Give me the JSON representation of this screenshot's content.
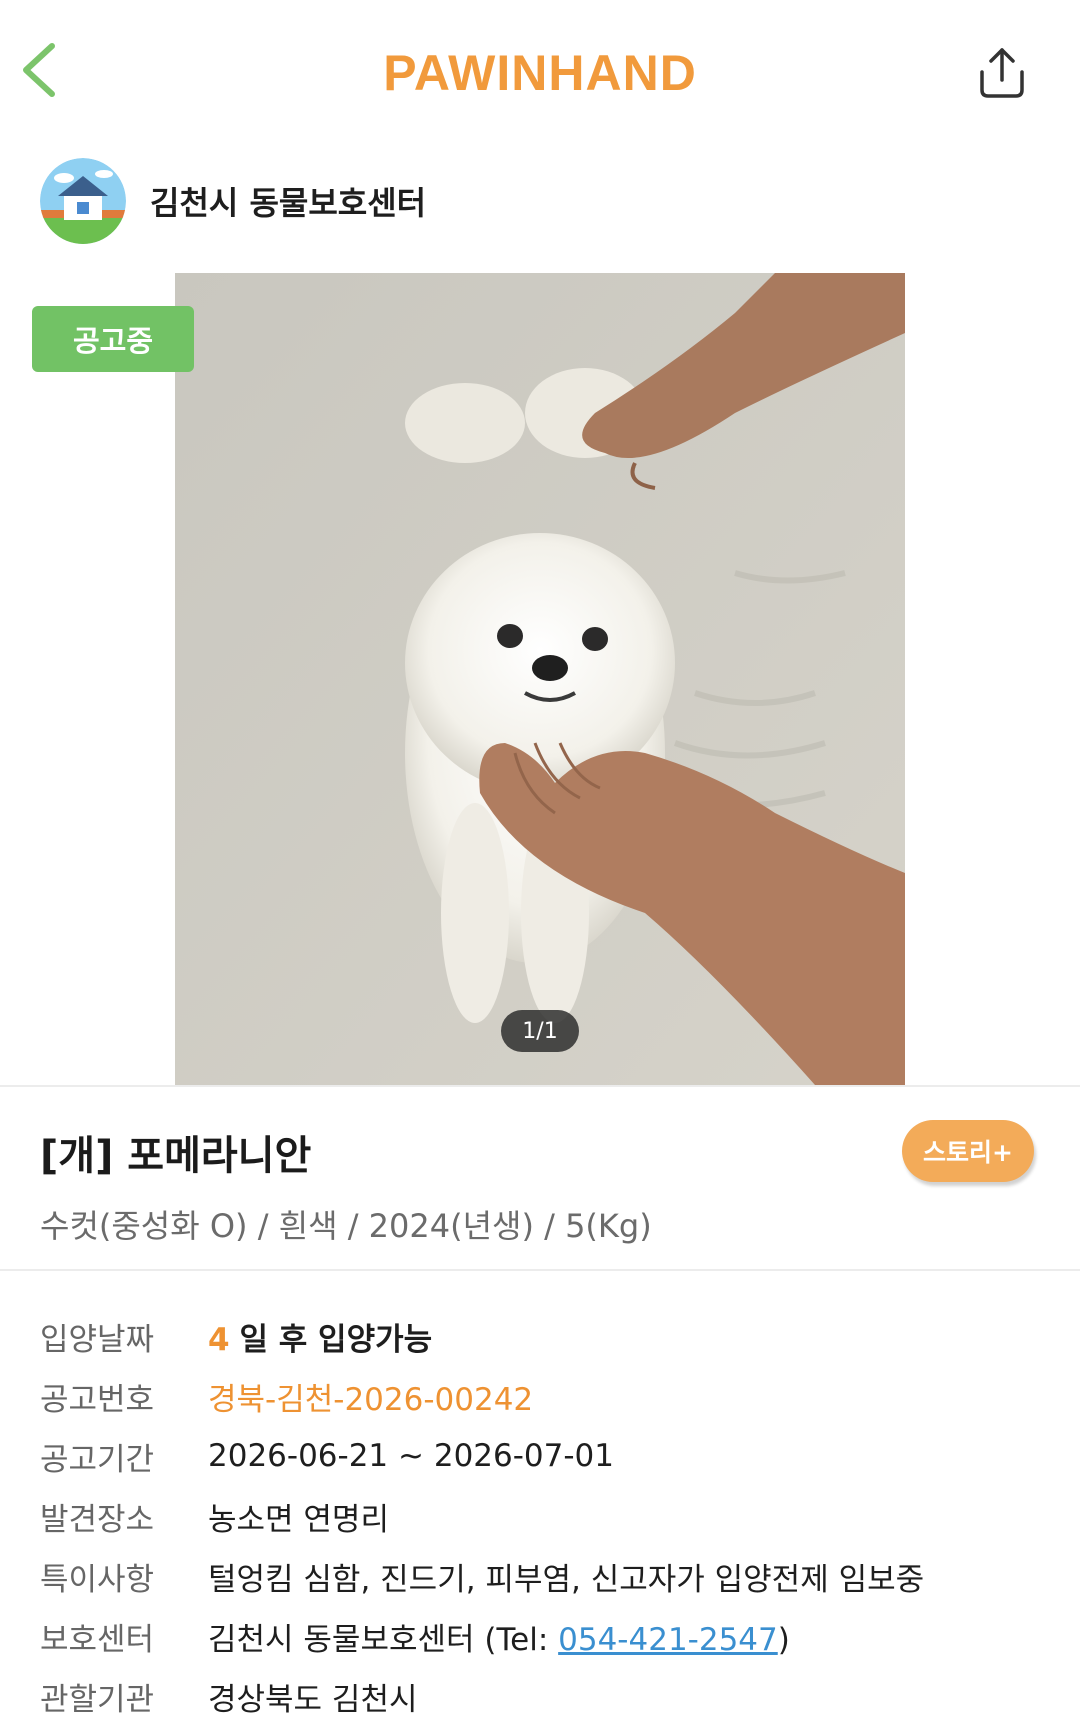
{
  "app": {
    "logo": "PAWINHAND",
    "accent_color": "#f19a3c",
    "back_icon": "chevron-left-icon",
    "share_icon": "share-icon"
  },
  "shelter": {
    "name": "김천시 동물보호센터",
    "avatar_icon": "house-icon"
  },
  "photo": {
    "status_badge": "공고중",
    "status_color": "#72c265",
    "counter": "1/1"
  },
  "pet": {
    "title": "[개] 포메라니안",
    "summary": "수컷(중성화 O) / 흰색 / 2024(년생) / 5(Kg)",
    "story_button": "스토리+"
  },
  "info": {
    "adoption_date": {
      "label": "입양날짜",
      "days": "4",
      "text": "일 후 입양가능"
    },
    "notice_number": {
      "label": "공고번호",
      "value": "경북-김천-2026-00242"
    },
    "notice_period": {
      "label": "공고기간",
      "value": "2026-06-21 ~ 2026-07-01"
    },
    "found_place": {
      "label": "발견장소",
      "value": "농소면 연명리"
    },
    "special_notes": {
      "label": "특이사항",
      "value": "털엉킴 심함, 진드기, 피부염, 신고자가 입양전제 임보중"
    },
    "shelter": {
      "label": "보호센터",
      "name": "김천시 동물보호센터 (Tel: ",
      "phone": "054-421-2547",
      "close": ")"
    },
    "authority": {
      "label": "관할기관",
      "value": "경상북도 김천시"
    }
  }
}
